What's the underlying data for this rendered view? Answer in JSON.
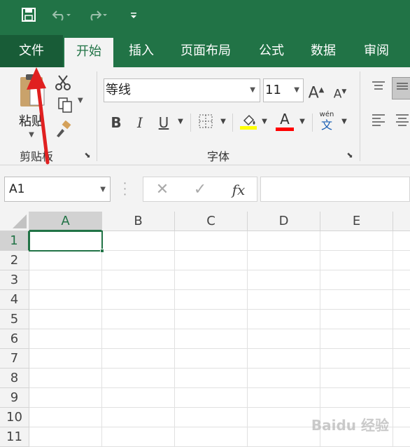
{
  "colors": {
    "brand": "#217346",
    "brand_dark": "#185c37",
    "ribbon_bg": "#f3f3f3",
    "arrow": "#e02020",
    "highlight_yellow": "#ffff00",
    "font_red": "#ff0000"
  },
  "tabs": [
    {
      "label": "文件"
    },
    {
      "label": "开始"
    },
    {
      "label": "插入"
    },
    {
      "label": "页面布局"
    },
    {
      "label": "公式"
    },
    {
      "label": "数据"
    },
    {
      "label": "审阅"
    }
  ],
  "clipboard": {
    "paste_label": "粘贴",
    "group_label": "剪贴板"
  },
  "font": {
    "name": "等线",
    "size": "11",
    "group_label": "字体",
    "bold": "B",
    "italic": "I",
    "underline": "U",
    "grow": "A",
    "shrink": "A",
    "color_a": "A",
    "fill_a": "A",
    "pinyin_top": "wén",
    "pinyin_char": "文"
  },
  "formula_bar": {
    "name_box": "A1",
    "fx": "fx",
    "value": ""
  },
  "columns": [
    "A",
    "B",
    "C",
    "D",
    "E"
  ],
  "rows": [
    "1",
    "2",
    "3",
    "4",
    "5",
    "6",
    "7",
    "8",
    "9",
    "10",
    "11"
  ],
  "selected_cell": "A1",
  "watermark": "Baidu 经验"
}
